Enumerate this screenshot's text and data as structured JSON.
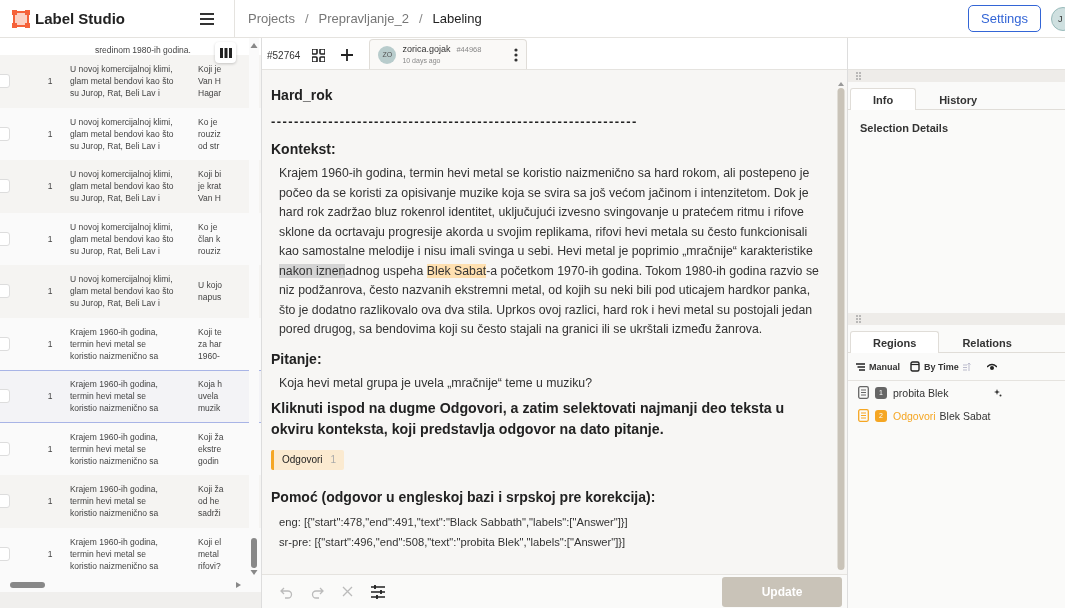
{
  "header": {
    "logo_text": "Label Studio",
    "breadcrumbs": [
      "Projects",
      "Prepravljanje_2",
      "Labeling"
    ],
    "breadcrumb_separator": "/",
    "settings_button": "Settings",
    "user_initials": "J"
  },
  "table": {
    "top_fragment": "sredinom 1980-ih godina.",
    "rows": [
      {
        "checked": false,
        "selected": false,
        "count": "1",
        "context_lines": [
          "U novoj komercijalnoj klimi,",
          "glam metal bendovi kao što",
          "su Jurop, Rat, Beli Lav i"
        ],
        "question_lines": [
          "Koji je",
          "Van H",
          "Hagar"
        ]
      },
      {
        "checked": false,
        "selected": false,
        "count": "1",
        "context_lines": [
          "U novoj komercijalnoj klimi,",
          "glam metal bendovi kao što",
          "su Jurop, Rat, Beli Lav i"
        ],
        "question_lines": [
          "Ko je",
          "rouziz",
          "od str"
        ]
      },
      {
        "checked": false,
        "selected": false,
        "count": "1",
        "context_lines": [
          "U novoj komercijalnoj klimi,",
          "glam metal bendovi kao što",
          "su Jurop, Rat, Beli Lav i"
        ],
        "question_lines": [
          "Koji bi",
          "je krat",
          "Van H"
        ]
      },
      {
        "checked": false,
        "selected": false,
        "count": "1",
        "context_lines": [
          "U novoj komercijalnoj klimi,",
          "glam metal bendovi kao što",
          "su Jurop, Rat, Beli Lav i"
        ],
        "question_lines": [
          "Ko je",
          "član k",
          "rouziz"
        ]
      },
      {
        "checked": false,
        "selected": false,
        "count": "1",
        "context_lines": [
          "U novoj komercijalnoj klimi,",
          "glam metal bendovi kao što",
          "su Jurop, Rat, Beli Lav i"
        ],
        "question_lines": [
          "U kojo",
          "napus"
        ]
      },
      {
        "checked": false,
        "selected": false,
        "count": "1",
        "context_lines": [
          "Krajem 1960-ih godina,",
          "termin hevi metal se",
          "koristio naizmenično sa"
        ],
        "question_lines": [
          "Koji te",
          "za har",
          "1960-"
        ]
      },
      {
        "checked": false,
        "selected": true,
        "count": "1",
        "context_lines": [
          "Krajem 1960-ih godina,",
          "termin hevi metal se",
          "koristio naizmenično sa"
        ],
        "question_lines": [
          "Koja h",
          "uvela",
          "muzik"
        ]
      },
      {
        "checked": false,
        "selected": false,
        "count": "1",
        "context_lines": [
          "Krajem 1960-ih godina,",
          "termin hevi metal se",
          "koristio naizmenično sa"
        ],
        "question_lines": [
          "Koji ža",
          "ekstre",
          "godin"
        ]
      },
      {
        "checked": false,
        "selected": false,
        "count": "1",
        "context_lines": [
          "Krajem 1960-ih godina,",
          "termin hevi metal se",
          "koristio naizmenično sa"
        ],
        "question_lines": [
          "Koji ža",
          "od he",
          "sadrži"
        ]
      },
      {
        "checked": false,
        "selected": false,
        "count": "1",
        "context_lines": [
          "Krajem 1960-ih godina,",
          "termin hevi metal se",
          "koristio naizmenično sa"
        ],
        "question_lines": [
          "Koji el",
          "metal",
          "rifovi?"
        ]
      }
    ]
  },
  "annotation_bar": {
    "task_id": "#52764",
    "tabs": [
      {
        "initials": "ZO",
        "user": "zorica.gojak",
        "id": "#44968",
        "time": "10 days ago",
        "selected": true
      }
    ]
  },
  "content": {
    "title": "Hard_rok",
    "divider": "----------------------------------------------------------------",
    "context_heading": "Kontekst:",
    "context_segments": [
      {
        "text": "Krajem 1960-ih godina, termin hevi metal se koristio naizmenično sa hard rokom, ali postepeno je počeo da se koristi za opisivanje muzike koja se svira sa još većom jačinom i intenzitetom. Dok je hard rok zadržao bluz rokenrol identitet, uključujući izvesno svingovanje u pratećem ritmu i rifove sklone da ocrtavaju progresije akorda u svojim replikama, rifovi hevi metala su često funkcionisali kao samostalne melodije i nisu imali svinga u sebi. Hevi metal je poprimio „mračnije“ karakteristike"
      },
      {
        "text": " nakon iznen",
        "color": "#d4d4d4"
      },
      {
        "text": "adnog uspeha "
      },
      {
        "text": "Blek Sabat",
        "color": "#ffe0b0"
      },
      {
        "text": "-a početkom 1970-ih godina. Tokom 1980-ih godina razvio se niz podžanrova, često nazvanih ekstremni metal, od kojih su neki bili pod uticajem hardkor panka, što je dodatno razlikovalo ova dva stila. Uprkos ovoj razlici, hard rok i hevi metal su postojali jedan pored drugog, sa bendovima koji su često stajali na granici ili se ukrštali između žanrova."
      }
    ],
    "question_heading": "Pitanje:",
    "question": "Koja hevi metal grupa je uvela „mračnije“ teme u muziku?",
    "instruction": "Kliknuti ispod na dugme Odgovori, a zatim selektovati najmanji deo teksta u okviru konteksta, koji predstavlja odgovor na dato pitanje.",
    "labels": [
      {
        "text": "Odgovori",
        "count": "1",
        "color": "#f5a623"
      }
    ],
    "help_heading": "Pomoć (odgovor u engleskoj bazi i srpskoj pre korekcija):",
    "help_lines": [
      "eng: [{\"start\":478,\"end\":491,\"text\":\"Black Sabbath\",\"labels\":[\"Answer\"]}]",
      "sr-pre: [{\"start\":496,\"end\":508,\"text\":\"probita Blek\",\"labels\":[\"Answer\"]}]"
    ]
  },
  "bottom_bar": {
    "undo_disabled": true,
    "redo_disabled": true,
    "update_button": "Update",
    "update_disabled": true
  },
  "side": {
    "top_tabs": [
      {
        "label": "Info",
        "selected": true
      },
      {
        "label": "History",
        "selected": false
      }
    ],
    "selection_title": "Selection Details",
    "bottom_tabs": [
      {
        "label": "Regions",
        "selected": true
      },
      {
        "label": "Relations",
        "selected": false
      }
    ],
    "order": "Manual",
    "sort": "By Time",
    "regions": [
      {
        "index": "1",
        "text": "probita Blek",
        "color": "#666666"
      },
      {
        "index": "2",
        "label": "Odgovori",
        "text": "Blek Sabat",
        "color": "#f5a623"
      }
    ]
  }
}
